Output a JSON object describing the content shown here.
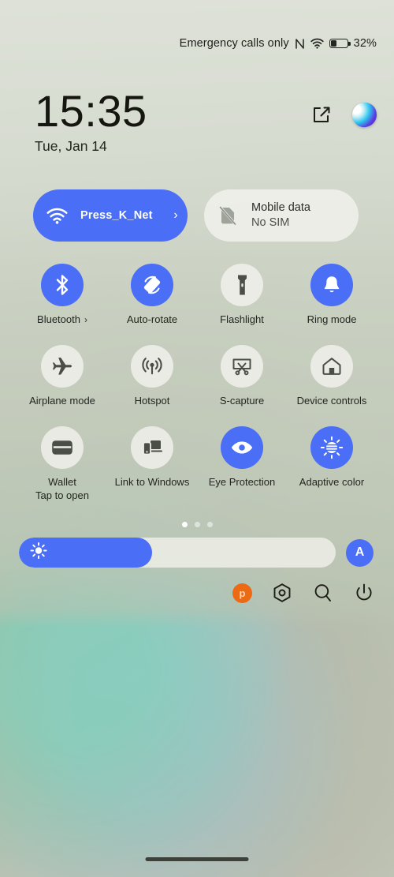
{
  "status_bar": {
    "carrier_text": "Emergency calls only",
    "nfc_icon": "nfc-icon",
    "wifi_icon": "wifi-icon",
    "battery_icon": "battery-icon",
    "battery_percent": "32%",
    "battery_level": 32
  },
  "header": {
    "time": "15:35",
    "date": "Tue, Jan 14",
    "edit_icon": "edit-icon",
    "profile_icon": "profile-blob-icon"
  },
  "connectivity_tiles": [
    {
      "name": "wifi",
      "icon": "wifi-icon",
      "title": "Press_K_Net",
      "subtitle": "",
      "active": true,
      "chevron": "›"
    },
    {
      "name": "mobile-data",
      "icon": "sim-off-icon",
      "title": "Mobile data",
      "subtitle": "No SIM",
      "active": false,
      "chevron": ""
    }
  ],
  "quick_tiles": [
    {
      "name": "bluetooth",
      "icon": "bluetooth-icon",
      "label": "Bluetooth",
      "sublabel": "",
      "active": true,
      "chevron": "›"
    },
    {
      "name": "auto-rotate",
      "icon": "auto-rotate-icon",
      "label": "Auto-rotate",
      "sublabel": "",
      "active": true,
      "chevron": ""
    },
    {
      "name": "flashlight",
      "icon": "flashlight-icon",
      "label": "Flashlight",
      "sublabel": "",
      "active": false,
      "chevron": ""
    },
    {
      "name": "ring-mode",
      "icon": "bell-icon",
      "label": "Ring mode",
      "sublabel": "",
      "active": true,
      "chevron": ""
    },
    {
      "name": "airplane-mode",
      "icon": "airplane-icon",
      "label": "Airplane mode",
      "sublabel": "",
      "active": false,
      "chevron": ""
    },
    {
      "name": "hotspot",
      "icon": "hotspot-icon",
      "label": "Hotspot",
      "sublabel": "",
      "active": false,
      "chevron": ""
    },
    {
      "name": "s-capture",
      "icon": "screenshot-crop-icon",
      "label": "S-capture",
      "sublabel": "",
      "active": false,
      "chevron": ""
    },
    {
      "name": "device-controls",
      "icon": "home-icon",
      "label": "Device controls",
      "sublabel": "",
      "active": false,
      "chevron": ""
    },
    {
      "name": "wallet",
      "icon": "wallet-icon",
      "label": "Wallet",
      "sublabel": "Tap to open",
      "active": false,
      "chevron": ""
    },
    {
      "name": "link-to-windows",
      "icon": "phone-link-icon",
      "label": "Link to Windows",
      "sublabel": "",
      "active": false,
      "chevron": ""
    },
    {
      "name": "eye-protection",
      "icon": "eye-icon",
      "label": "Eye Protection",
      "sublabel": "",
      "active": true,
      "chevron": ""
    },
    {
      "name": "adaptive-color",
      "icon": "adaptive-color-icon",
      "label": "Adaptive color",
      "sublabel": "",
      "active": true,
      "chevron": ""
    }
  ],
  "pager": {
    "total": 3,
    "active_index": 0
  },
  "brightness": {
    "icon": "brightness-sun-icon",
    "value_percent": 42,
    "auto_label": "A",
    "auto_enabled": true
  },
  "footer": [
    {
      "name": "user-avatar",
      "icon": "user-avatar-icon",
      "label": "p"
    },
    {
      "name": "settings-button",
      "icon": "settings-hexagon-icon",
      "label": ""
    },
    {
      "name": "search-button",
      "icon": "search-icon",
      "label": ""
    },
    {
      "name": "power-button",
      "icon": "power-icon",
      "label": ""
    }
  ],
  "colors": {
    "accent_blue": "#4a6ef5",
    "inactive_tile": "#f3f3ee",
    "avatar_orange": "#ec6a14",
    "text_primary": "#23261f"
  },
  "gesture_bar": "home-gesture-bar"
}
